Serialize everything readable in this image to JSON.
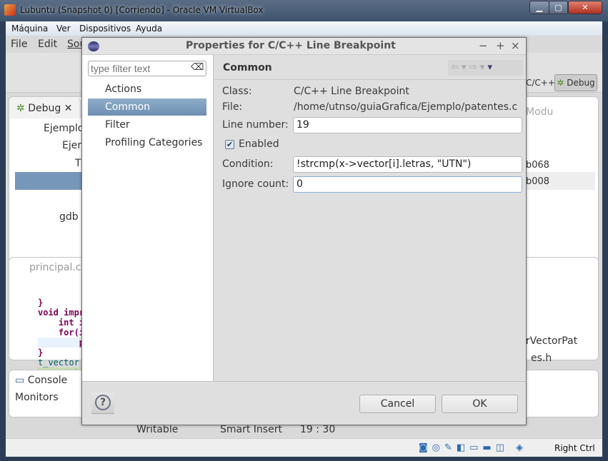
{
  "window": {
    "title": "Lubuntu (Snapshot 0) [Corriendo] - Oracle VM VirtualBox",
    "minimize": "▁",
    "maximize": "▢",
    "close": "✕"
  },
  "vm_menu": [
    "Máquina",
    "Ver",
    "Dispositivos",
    "Ayuda"
  ],
  "eclipse": {
    "menu": [
      "File",
      "Edit",
      "Sou"
    ],
    "perspectives": {
      "cpp": "C/C++",
      "debug": "Debug"
    },
    "debug_view": {
      "tab": "Debug",
      "tree": [
        "Ejemplo",
        "Ejemp",
        "Thr",
        "",
        "",
        "gdb"
      ]
    },
    "modules_view": {
      "tab": "Modu",
      "rows": [
        "b068",
        "b008"
      ]
    },
    "editor": {
      "tab": "principal.c",
      "lines": [
        "}",
        "void impr",
        "    int i",
        "    for(i",
        "        p",
        "}",
        "t_vector",
        "    vecto"
      ]
    },
    "outline": {
      "items": [
        "es.h",
        "zarVectorPat"
      ]
    },
    "console": {
      "tab": "Console",
      "content": "Monitors"
    },
    "status": {
      "writable": "Writable",
      "insert_mode": "Smart Insert",
      "position": "19 : 30"
    }
  },
  "dialog": {
    "title": "Properties for C/C++ Line Breakpoint",
    "controls": {
      "minimize": "−",
      "maximize": "+",
      "close": "×"
    },
    "filter_placeholder": "type filter text",
    "nav": [
      "Actions",
      "Common",
      "Filter",
      "Profiling Categories"
    ],
    "selected_nav": "Common",
    "page_title": "Common",
    "class_label": "Class:",
    "class_value": "C/C++ Line Breakpoint",
    "file_label": "File:",
    "file_value": "/home/utnso/guiaGrafica/Ejemplo/patentes.c",
    "line_label": "Line number:",
    "line_value": "19",
    "enabled_label": "Enabled",
    "enabled": true,
    "condition_label": "Condition:",
    "condition_value": "!strcmp(x->vector[i].letras, \"UTN\")",
    "ignore_label": "Ignore count:",
    "ignore_value": "0",
    "help": "?",
    "cancel": "Cancel",
    "ok": "OK"
  },
  "vm_status": {
    "host_key": "Right Ctrl"
  }
}
